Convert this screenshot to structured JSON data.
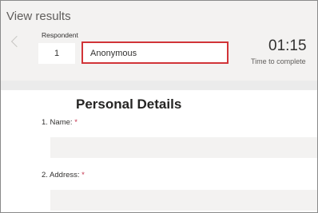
{
  "header": {
    "title": "View results",
    "respondent_label": "Respondent",
    "respondent_number": "1",
    "respondent_name": "Anonymous",
    "time_value": "01:15",
    "time_label": "Time to complete"
  },
  "form": {
    "section_title": "Personal Details",
    "questions": [
      {
        "label": "1. Name:",
        "required_mark": "*"
      },
      {
        "label": "2. Address:",
        "required_mark": "*"
      }
    ]
  },
  "colors": {
    "highlight_outline": "#d13438",
    "required": "#c4314b",
    "header_bg": "#f3f2f1"
  }
}
